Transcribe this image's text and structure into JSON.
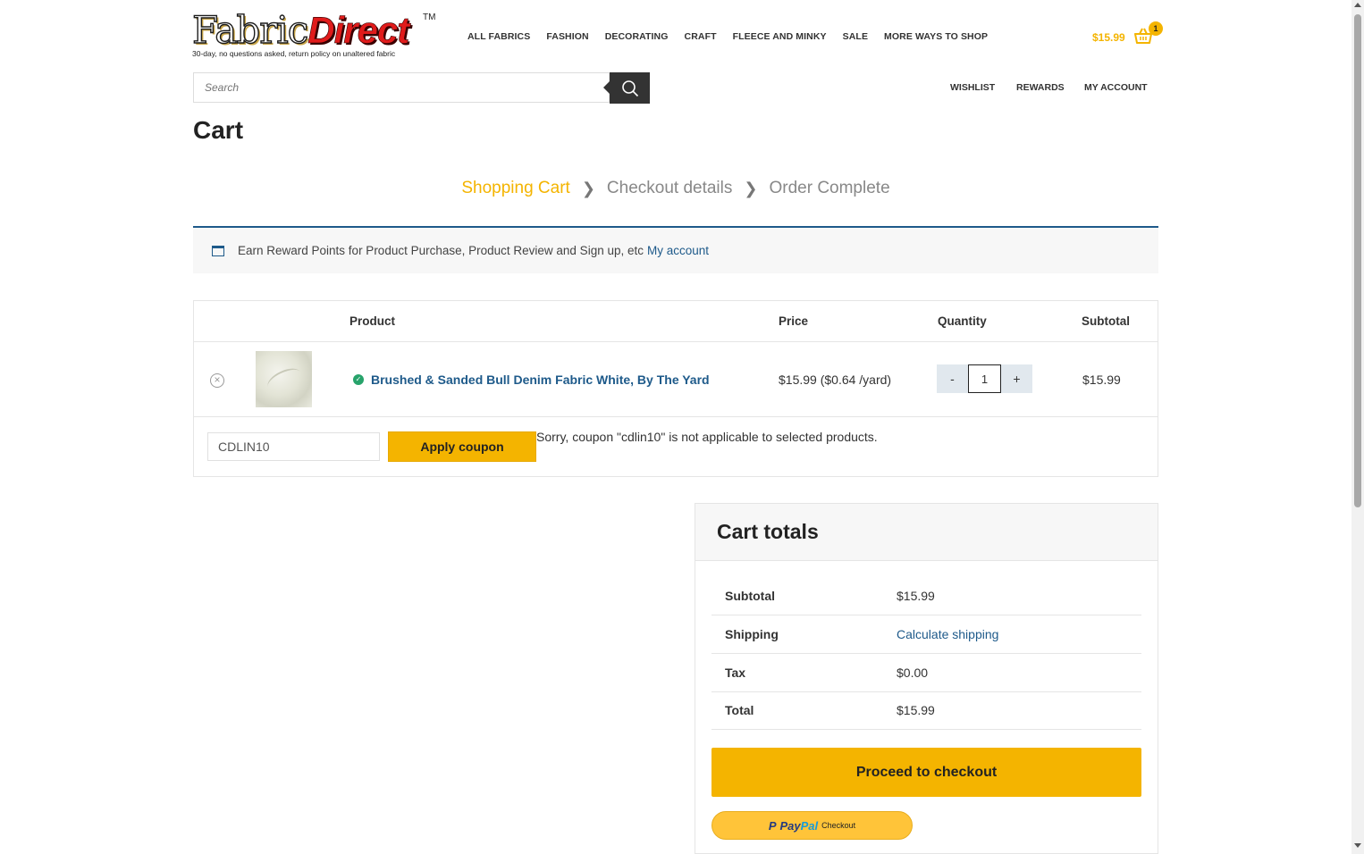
{
  "brand": {
    "logo_word1": "Fabric",
    "logo_word2": "Direct",
    "trademark": "TM",
    "tagline": "30-day, no questions asked, return policy on unaltered fabric"
  },
  "nav": {
    "items": [
      "ALL FABRICS",
      "FASHION",
      "DECORATING",
      "CRAFT",
      "FLEECE AND MINKY",
      "SALE",
      "MORE WAYS TO SHOP"
    ]
  },
  "header_cart": {
    "amount": "$15.99",
    "count": "1",
    "icon": "basket-icon"
  },
  "search": {
    "placeholder": "Search",
    "icon": "search-icon"
  },
  "account_nav": {
    "wishlist": "WISHLIST",
    "rewards": "REWARDS",
    "my_account": "MY ACCOUNT"
  },
  "page_title": "Cart",
  "steps": {
    "step1": "Shopping Cart",
    "step2": "Checkout details",
    "step3": "Order Complete"
  },
  "notice": {
    "text": "Earn Reward Points for Product Purchase, Product Review and Sign up, etc",
    "link": "My account"
  },
  "cart_table": {
    "headers": {
      "product": "Product",
      "price": "Price",
      "quantity": "Quantity",
      "subtotal": "Subtotal"
    },
    "rows": [
      {
        "name": "Brushed & Sanded Bull Denim Fabric White, By The Yard",
        "price": "$15.99 ($0.64 /yard)",
        "quantity": "1",
        "subtotal": "$15.99"
      }
    ],
    "qty_minus": "-",
    "qty_plus": "+",
    "remove_symbol": "×"
  },
  "coupon": {
    "value": "CDLIN10",
    "button": "Apply coupon",
    "message": "Sorry, coupon \"cdlin10\" is not applicable to selected products."
  },
  "totals": {
    "title": "Cart totals",
    "subtotal_label": "Subtotal",
    "subtotal_value": "$15.99",
    "shipping_label": "Shipping",
    "shipping_value": "Calculate shipping",
    "tax_label": "Tax",
    "tax_value": "$0.00",
    "total_label": "Total",
    "total_value": "$15.99",
    "checkout_button": "Proceed to checkout",
    "paypal_mark": "P",
    "paypal_pay": "Pay",
    "paypal_pal": "Pal",
    "paypal_checkout": "Checkout"
  },
  "colors": {
    "accent": "#f4b400",
    "link": "#1e5a8a",
    "success": "#27a36b"
  }
}
